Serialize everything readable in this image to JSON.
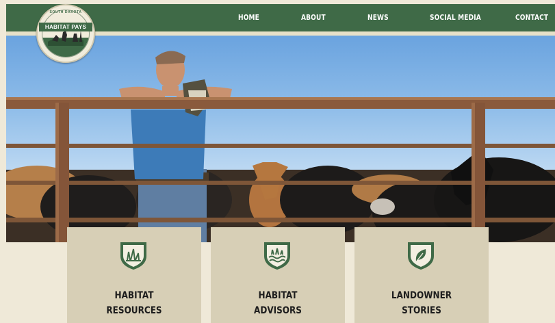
{
  "logo": {
    "top_text": "SOUTH DAKOTA",
    "banner_text": "HABITAT PAYS",
    "icon": "habitat-pays-seal"
  },
  "nav": {
    "items": [
      "HOME",
      "ABOUT",
      "NEWS",
      "SOCIAL MEDIA",
      "CONTACT"
    ]
  },
  "hero": {
    "image": "rancher-leaning-on-cattle-fence"
  },
  "cards": [
    {
      "line1": "HABITAT",
      "line2": "RESOURCES",
      "icon": "grass-icon"
    },
    {
      "line1": "HABITAT",
      "line2": "ADVISORS",
      "icon": "wetland-icon"
    },
    {
      "line1": "LANDOWNER",
      "line2": "STORIES",
      "icon": "leaf-icon"
    }
  ],
  "colors": {
    "brand_green": "#3f6a47",
    "cream": "#efe9d8",
    "card_tan": "#d7cfb6"
  }
}
